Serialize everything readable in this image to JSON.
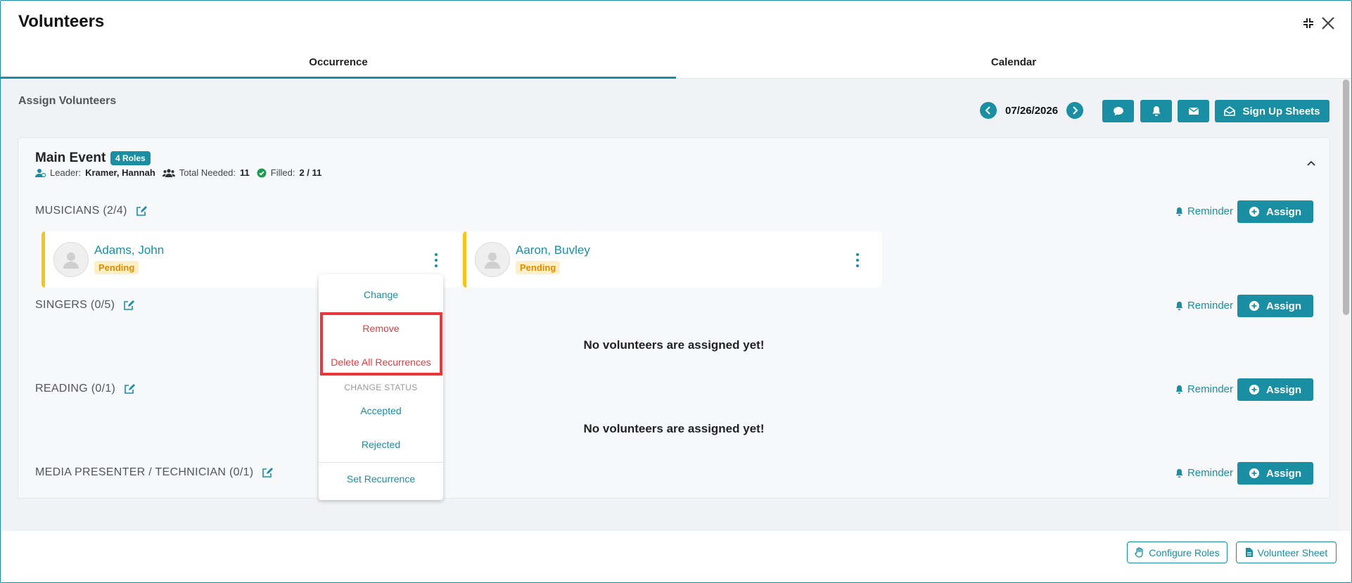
{
  "window": {
    "title": "Volunteers"
  },
  "tabs": [
    {
      "label": "Occurrence"
    },
    {
      "label": "Calendar"
    }
  ],
  "header": {
    "assign_title": "Assign Volunteers",
    "date": "07/26/2026",
    "signup_label": "Sign Up Sheets"
  },
  "event": {
    "title": "Main Event",
    "roles_badge": "4 Roles",
    "leader_label": "Leader:",
    "leader_name": "Kramer, Hannah",
    "total_label": "Total Needed:",
    "total_value": "11",
    "filled_label": "Filled:",
    "filled_value": "2 / 11"
  },
  "roles": [
    {
      "name": "MUSICIANS (2/4)"
    },
    {
      "name": "SINGERS (0/5)"
    },
    {
      "name": "READING (0/1)"
    },
    {
      "name": "MEDIA PRESENTER / TECHNICIAN (0/1)"
    }
  ],
  "actions": {
    "reminder_label": "Reminder",
    "assign_label": "Assign"
  },
  "volunteers": [
    {
      "name": "Adams, John",
      "status": "Pending"
    },
    {
      "name": "Aaron, Buvley",
      "status": "Pending"
    }
  ],
  "empty_message": "No volunteers are assigned yet!",
  "menu": {
    "change": "Change",
    "remove": "Remove",
    "delete_all": "Delete All Recurrences",
    "status_header": "CHANGE STATUS",
    "accepted": "Accepted",
    "rejected": "Rejected",
    "set_recurrence": "Set Recurrence"
  },
  "footer": {
    "configure_roles": "Configure Roles",
    "volunteer_sheet": "Volunteer Sheet"
  },
  "colors": {
    "accent": "#1a8fa3",
    "pending_bg": "#fdf0c8",
    "pending_text": "#e08b00",
    "danger": "#e8383d",
    "card_stripe": "#f5c518"
  }
}
